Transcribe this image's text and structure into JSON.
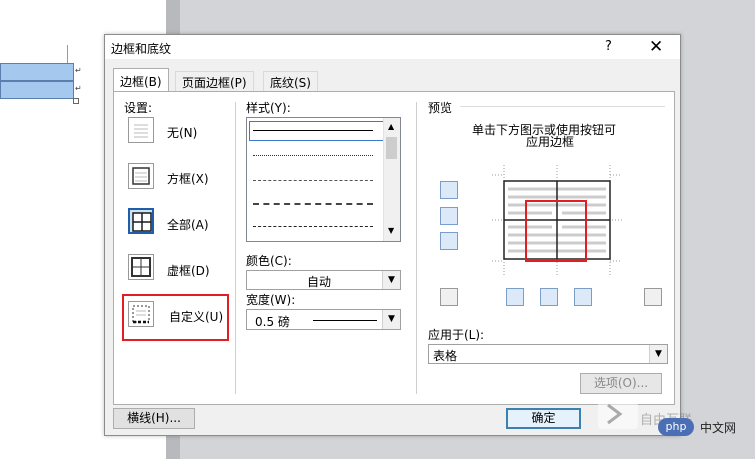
{
  "document": {
    "cell_marks": [
      "↵",
      "↵"
    ]
  },
  "dialog": {
    "title": "边框和底纹",
    "help": "?",
    "close": "✕",
    "tabs": [
      {
        "label": "边框(B)"
      },
      {
        "label": "页面边框(P)"
      },
      {
        "label": "底纹(S)"
      }
    ],
    "settings": {
      "label": "设置:",
      "items": [
        {
          "label": "无(N)"
        },
        {
          "label": "方框(X)"
        },
        {
          "label": "全部(A)",
          "selected": true
        },
        {
          "label": "虚框(D)"
        },
        {
          "label": "自定义(U)",
          "highlighted": true
        }
      ]
    },
    "style": {
      "label": "样式(Y):",
      "items": [
        "solid",
        "dotted",
        "dashed-fine",
        "dashed",
        "dash-dot"
      ],
      "selected": "solid"
    },
    "color": {
      "label": "颜色(C):",
      "value": "自动"
    },
    "width": {
      "label": "宽度(W):",
      "value": "0.5 磅"
    },
    "preview": {
      "label": "预览",
      "hint_line1": "单击下方图示或使用按钮可",
      "hint_line2": "应用边框"
    },
    "apply_to": {
      "label": "应用于(L):",
      "value": "表格"
    },
    "options_button": "选项(O)...",
    "horizontal_line_button": "横线(H)...",
    "ok_button": "确定",
    "colors": {
      "accent": "#1f5ea8",
      "highlight": "#e02020"
    }
  },
  "watermark": {
    "badge": "php",
    "text": "中文网",
    "logo_text": "自由互联"
  }
}
